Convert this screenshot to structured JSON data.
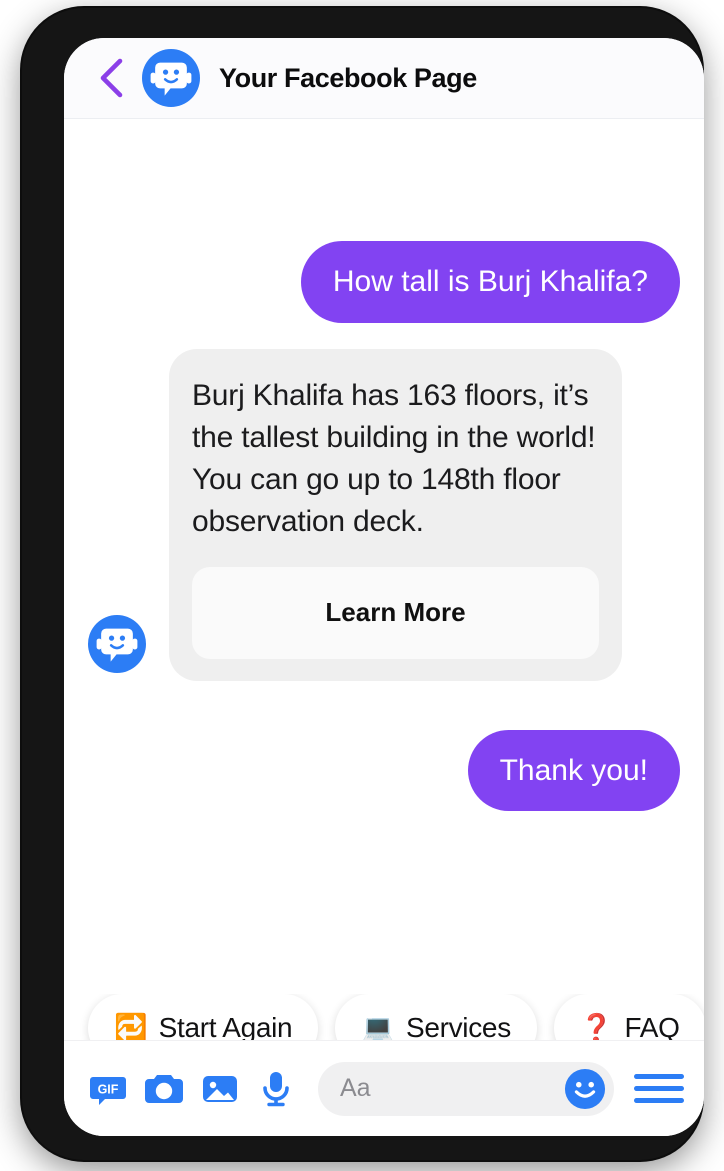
{
  "header": {
    "back_icon": "chevron-left-icon",
    "back_color": "#8B3FE8",
    "avatar_icon": "bot-avatar-icon",
    "title": "Your Facebook Page"
  },
  "colors": {
    "user_bubble": "#8243F2",
    "bot_bubble": "#EFEFEF",
    "accent_blue": "#2C7DF5",
    "back_chevron": "#8B3FE8",
    "page_background": "#FFFFFF"
  },
  "conversation": {
    "messages": [
      {
        "sender": "user",
        "text": "How tall is Burj Khalifa?"
      },
      {
        "sender": "bot",
        "text": "Burj Khalifa has 163 floors, it’s the tallest building in the world! You can go up to 148th floor observation deck.",
        "button_label": "Learn More"
      },
      {
        "sender": "user",
        "text": "Thank you!"
      }
    ]
  },
  "quick_replies": [
    {
      "emoji": "🔁",
      "label": "Start Again",
      "icon_name": "repeat-icon"
    },
    {
      "emoji": "💻",
      "label": "Services",
      "icon_name": "laptop-icon"
    },
    {
      "emoji": "❓",
      "label": "FAQ",
      "icon_name": "question-mark-icon"
    }
  ],
  "composer": {
    "tools": [
      {
        "icon_name": "gif-icon",
        "label": "GIF"
      },
      {
        "icon_name": "camera-icon",
        "label": "Camera"
      },
      {
        "icon_name": "photo-icon",
        "label": "Photos"
      },
      {
        "icon_name": "microphone-icon",
        "label": "Voice"
      }
    ],
    "input_placeholder": "Aa",
    "input_value": "",
    "emoji_button_icon": "smiley-icon",
    "menu_button_icon": "hamburger-menu-icon"
  }
}
